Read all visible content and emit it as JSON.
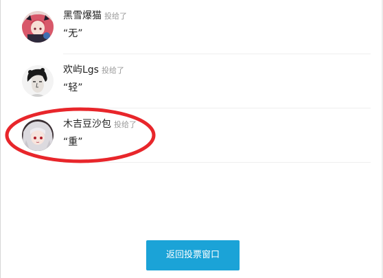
{
  "votes": [
    {
      "name": "黑雪爆猫",
      "verb": "投给了",
      "choice": "“无”",
      "avatar_icon": "anime-girl-pink-hair-avatar"
    },
    {
      "name": "欢屿Lgs",
      "verb": "投给了",
      "choice": "“轻”",
      "avatar_icon": "curly-hair-sketch-avatar"
    },
    {
      "name": "木吉豆沙包",
      "verb": "投给了",
      "choice": "“重”",
      "avatar_icon": "anime-girl-white-hair-avatar"
    }
  ],
  "annotation": {
    "color": "#e8262b"
  },
  "colors": {
    "button": "#1ba3d7",
    "text": "#222222",
    "muted": "#999999"
  },
  "footer": {
    "return_label": "返回投票窗口"
  }
}
